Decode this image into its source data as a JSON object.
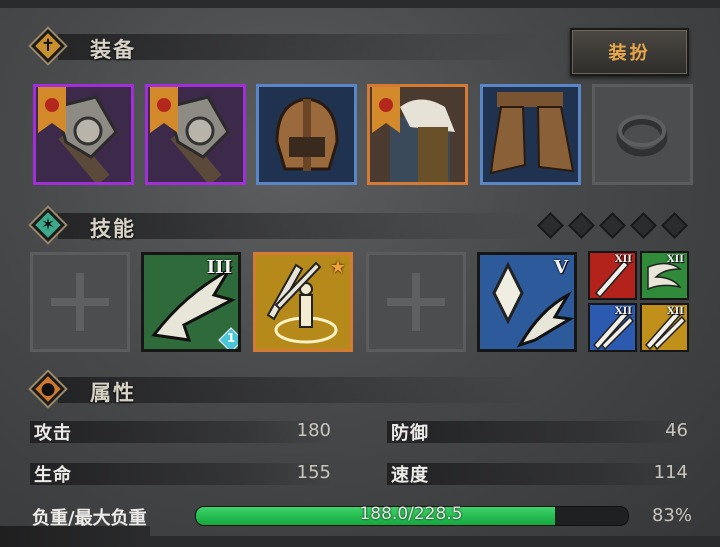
{
  "equipment": {
    "title": "装备",
    "dress_button": "装扮",
    "slots": [
      {
        "name": "axe-1",
        "rarity": "purple",
        "icon": "axe-icon",
        "banner": true
      },
      {
        "name": "axe-2",
        "rarity": "purple",
        "icon": "axe-icon",
        "banner": false
      },
      {
        "name": "helmet",
        "rarity": "blue",
        "icon": "helmet-icon",
        "banner": false
      },
      {
        "name": "armor",
        "rarity": "orange",
        "icon": "fur-armor-icon",
        "banner": true
      },
      {
        "name": "boots",
        "rarity": "blue",
        "icon": "boots-icon",
        "banner": false
      },
      {
        "name": "ring",
        "rarity": "empty",
        "icon": "ring-icon",
        "banner": false
      }
    ]
  },
  "skills": {
    "title": "技能",
    "pip_count": 5,
    "slots": [
      {
        "state": "empty",
        "icon": "cross-icon"
      },
      {
        "state": "green",
        "icon": "slash-skill-icon",
        "level": "III",
        "badge": "1"
      },
      {
        "state": "gold",
        "icon": "sword-aura-skill-icon",
        "star": true
      },
      {
        "state": "empty",
        "icon": "cross-icon"
      },
      {
        "state": "blue",
        "icon": "crystal-skill-icon",
        "level": "V"
      }
    ],
    "mini": [
      {
        "color": "red",
        "icon": "sword-icon",
        "level": "XII"
      },
      {
        "color": "green",
        "icon": "wind-icon",
        "level": "XII"
      },
      {
        "color": "blue",
        "icon": "crossed-swords-icon",
        "level": "XII"
      },
      {
        "color": "gold",
        "icon": "crossed-swords-icon",
        "level": "XII"
      }
    ]
  },
  "attributes": {
    "title": "属性",
    "stats": [
      {
        "label": "攻击",
        "value": "180"
      },
      {
        "label": "防御",
        "value": "46"
      },
      {
        "label": "生命",
        "value": "155"
      },
      {
        "label": "速度",
        "value": "114"
      }
    ],
    "weight": {
      "label": "负重/最大负重",
      "text": "188.0/228.5",
      "fill": 0.83,
      "percent": "83%"
    }
  },
  "colors": {
    "purple": "#a02fd8",
    "blue": "#5a86c6",
    "orange": "#d47a34",
    "green_bar": "#22c052",
    "accent_text": "#e8a84a"
  }
}
